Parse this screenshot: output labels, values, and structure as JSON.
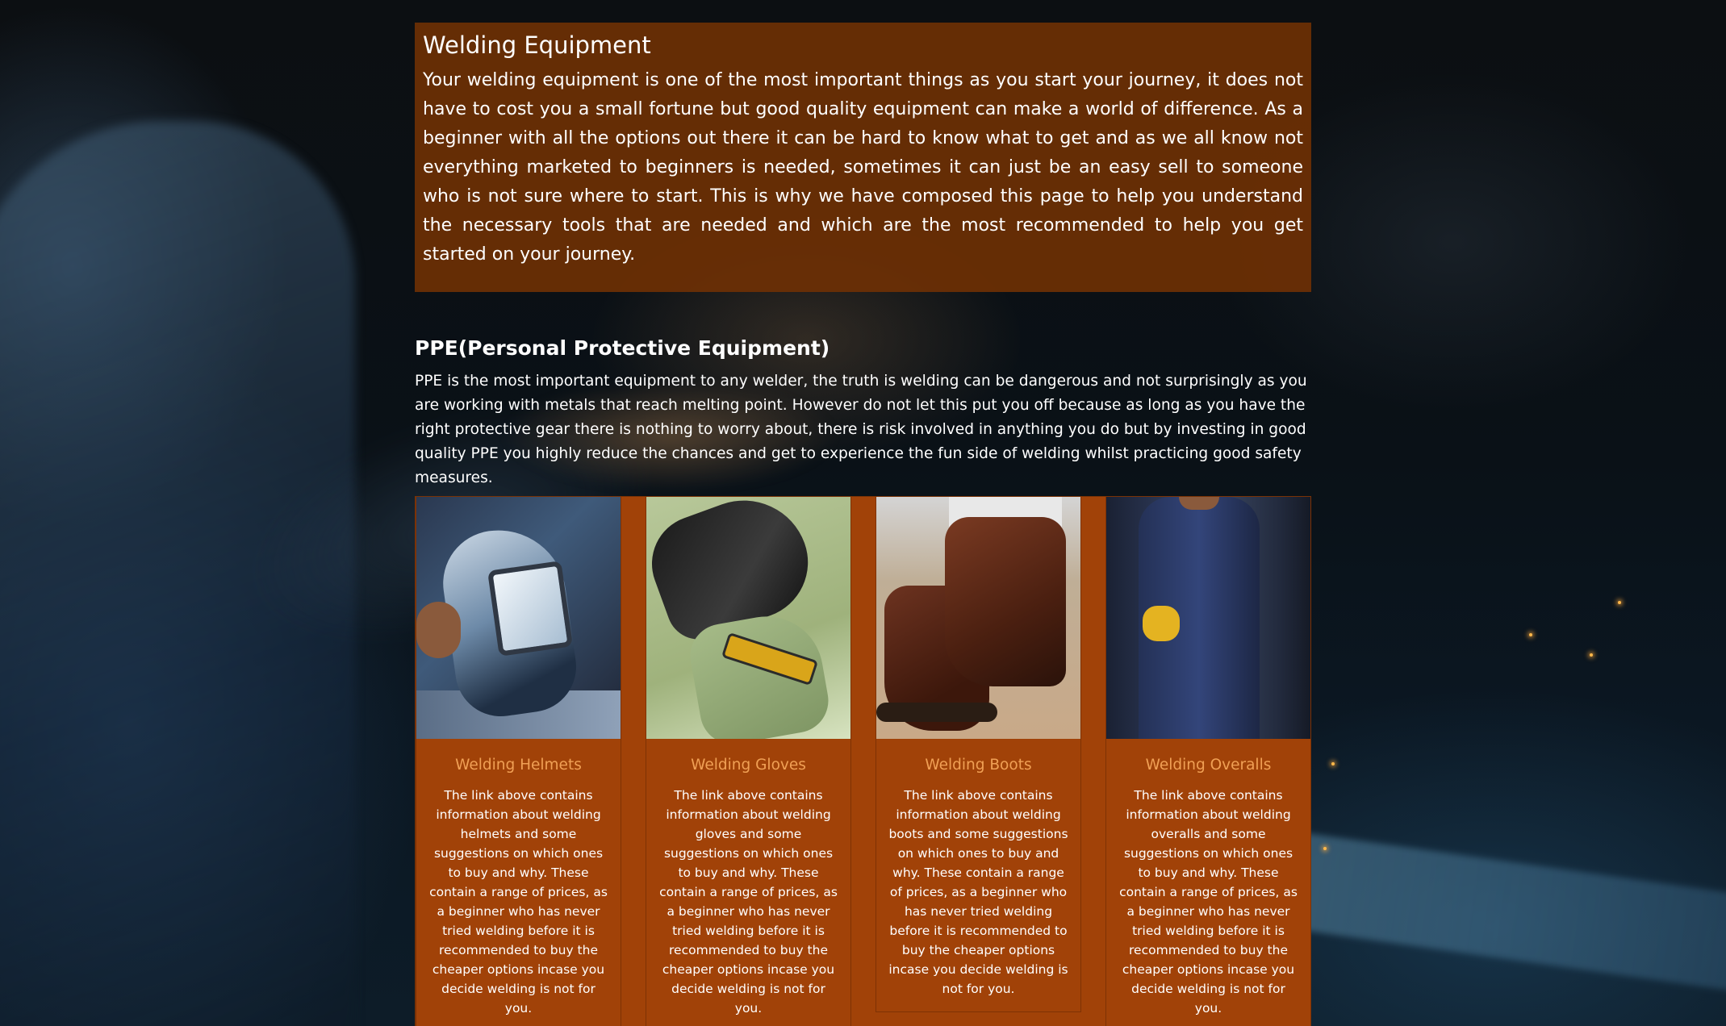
{
  "intro": {
    "title": "Welding Equipment",
    "text": "Your welding equipment is one of the most important things as you start your journey, it does not have to cost you a small fortune but good quality equipment can make a world of difference. As a beginner with all the options out there it can be hard to know what to get and as we all know not everything marketed to beginners is needed, sometimes it can just be an easy sell to someone who is not sure where to start. This is why we have composed this page to help you understand the necessary tools that are needed and which are the most recommended to help you get started on your journey."
  },
  "ppe": {
    "heading": "PPE(Personal Protective Equipment)",
    "text": "PPE is the most important equipment to any welder, the truth is welding can be dangerous and not surprisingly as you are working with metals that reach melting point. However do not let this put you off because as long as you have the right protective gear there is nothing to worry about, there is risk involved in anything you do but by investing in good quality PPE you highly reduce the chances and get to experience the fun side of welding whilst practicing good safety measures."
  },
  "cards": [
    {
      "title": "Welding Helmets",
      "text": "The link above contains information about welding helmets and some suggestions on which ones to buy and why. These contain a range of prices, as a beginner who has never tried welding before it is recommended to buy the cheaper options incase you decide welding is not for you."
    },
    {
      "title": "Welding Gloves",
      "text": "The link above contains information about welding gloves and some suggestions on which ones to buy and why. These contain a range of prices, as a beginner who has never tried welding before it is recommended to buy the cheaper options incase you decide welding is not for you."
    },
    {
      "title": "Welding Boots",
      "text": "The link above contains information about welding boots and some suggestions on which ones to buy and why. These contain a range of prices, as a beginner who has never tried welding before it is recommended to buy the cheaper options incase you decide welding is not for you."
    },
    {
      "title": "Welding Overalls",
      "text": "The link above contains information about welding overalls and some suggestions on which ones to buy and why. These contain a range of prices, as a beginner who has never tried welding before it is recommended to buy the cheaper options incase you decide welding is not for you."
    }
  ],
  "colors": {
    "intro_background": "#6e3004",
    "card_background": "#a14208",
    "card_title": "#f0a055",
    "page_background": "#0b0d0f"
  },
  "icons": [
    "welding-helmet-image",
    "welding-gloves-image",
    "welding-boots-image",
    "welding-overalls-image"
  ]
}
